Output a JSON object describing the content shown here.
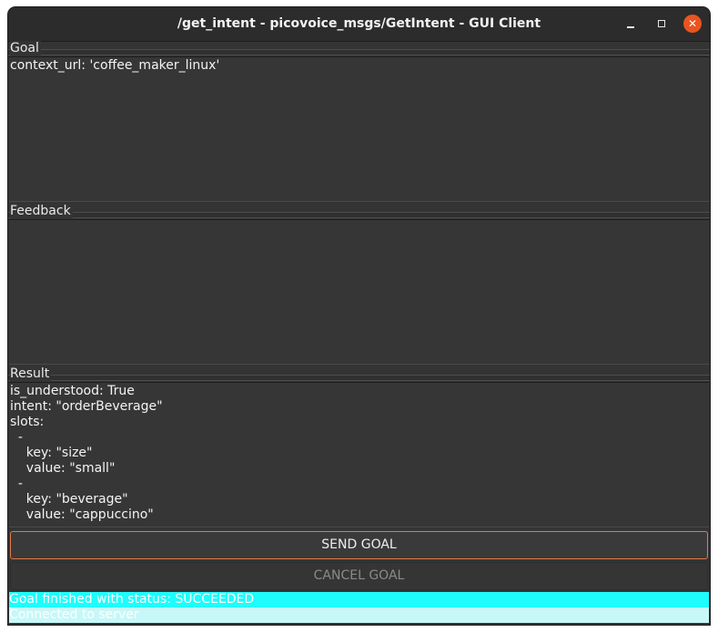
{
  "window": {
    "title": "/get_intent - picovoice_msgs/GetIntent - GUI Client",
    "close_glyph": "✕"
  },
  "goal": {
    "label": "Goal",
    "text": "context_url: 'coffee_maker_linux'"
  },
  "feedback": {
    "label": "Feedback",
    "text": ""
  },
  "result": {
    "label": "Result",
    "text": "is_understood: True\nintent: \"orderBeverage\"\nslots:\n  -\n    key: \"size\"\n    value: \"small\"\n  -\n    key: \"beverage\"\n    value: \"cappuccino\""
  },
  "buttons": {
    "send": "SEND GOAL",
    "cancel": "CANCEL GOAL"
  },
  "status": {
    "line1": "Goal finished with status: SUCCEEDED",
    "line2": "Connected to server"
  },
  "colors": {
    "accent": "#e95420",
    "status_highlight": "#1efcfc"
  }
}
